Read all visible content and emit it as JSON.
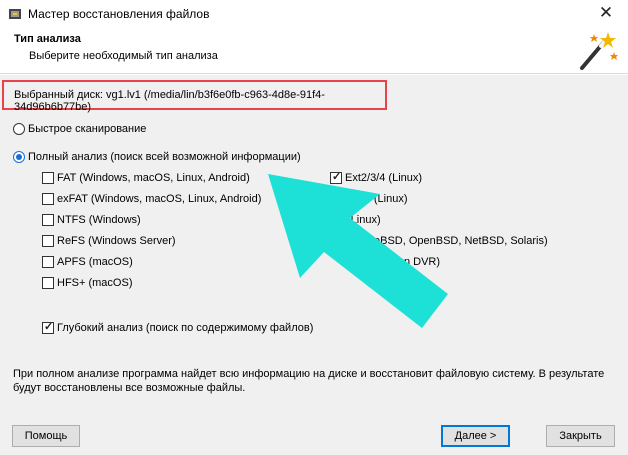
{
  "window": {
    "title": "Мастер восстановления файлов",
    "close_glyph": "✕"
  },
  "header": {
    "title": "Тип анализа",
    "subtitle": "Выберите необходимый тип анализа"
  },
  "disk": {
    "label": "Выбранный диск: vg1.lv1 (/media/lin/b3f6e0fb-c963-4d8e-91f4-34d96b6b77be)"
  },
  "options": {
    "quick": {
      "label": "Быстрое сканирование",
      "selected": false
    },
    "full": {
      "label": "Полный анализ (поиск всей возможной информации)",
      "selected": true
    }
  },
  "filesystems_left": [
    {
      "label": "FAT (Windows, macOS, Linux, Android)",
      "checked": false
    },
    {
      "label": "exFAT (Windows, macOS, Linux, Android)",
      "checked": false
    },
    {
      "label": "NTFS (Windows)",
      "checked": false
    },
    {
      "label": "ReFS (Windows Server)",
      "checked": false
    },
    {
      "label": "APFS (macOS)",
      "checked": false
    },
    {
      "label": "HFS+ (macOS)",
      "checked": false
    }
  ],
  "filesystems_right": [
    {
      "label": "Ext2/3/4 (Linux)",
      "checked": true
    },
    {
      "label": "erFS (Linux)"
    },
    {
      "label": "(Linux)"
    },
    {
      "label": "eBSD, OpenBSD, NetBSD, Solaris)"
    },
    {
      "label": "ikvision DVR)"
    }
  ],
  "deep_scan": {
    "label": "Глубокий анализ (поиск по содержимому файлов)",
    "checked": true
  },
  "info_text": "При полном анализе программа найдет всю информацию на диске и восстановит файловую систему. В результате будут восстановлены все возможные файлы.",
  "buttons": {
    "help": "Помощь",
    "next": "Далее >",
    "close": "Закрыть"
  },
  "colors": {
    "highlight_border": "#e8434a",
    "arrow": "#1de0d6",
    "radio_accent": "#1a6fd6"
  },
  "icons": {
    "app": "recovery-app-icon",
    "wizard": "magic-wand-icon",
    "pointer": "arrow-annotation"
  }
}
